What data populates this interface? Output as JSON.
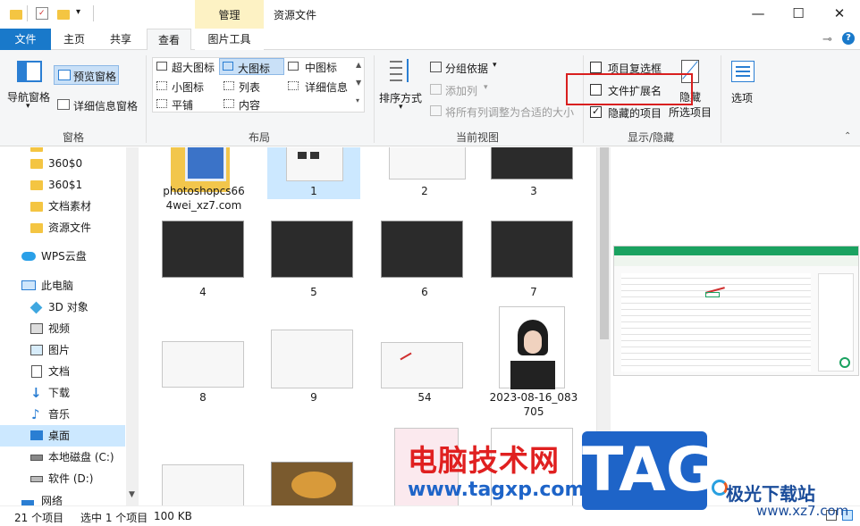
{
  "window": {
    "context_tab": "管理",
    "title": "资源文件",
    "minimize": "—",
    "maximize": "☐",
    "close": "✕"
  },
  "tabs": {
    "file": "文件",
    "home": "主页",
    "share": "共享",
    "view": "查看",
    "picture_tools": "图片工具"
  },
  "ribbon": {
    "panes": {
      "nav_pane": "导航窗格",
      "preview_pane": "预览窗格",
      "details_pane": "详细信息窗格",
      "label": "窗格"
    },
    "layout": {
      "extra_large": "超大图标",
      "large": "大图标",
      "medium": "中图标",
      "small": "小图标",
      "list": "列表",
      "details": "详细信息",
      "tiles": "平铺",
      "content": "内容",
      "label": "布局"
    },
    "current_view": {
      "sort_by": "排序方式",
      "group_by": "分组依据",
      "add_columns": "添加列",
      "size_all_columns": "将所有列调整为合适的大小",
      "label": "当前视图"
    },
    "show_hide": {
      "item_checkboxes": "项目复选框",
      "file_extensions": "文件扩展名",
      "hidden_items": "隐藏的项目",
      "hide_selected": "隐藏",
      "hide_selected_2": "所选项目",
      "label": "显示/隐藏"
    },
    "options": "选项"
  },
  "nav": {
    "items": [
      "360$0",
      "360$1",
      "文档素材",
      "资源文件",
      "WPS云盘",
      "此电脑",
      "3D 对象",
      "视频",
      "图片",
      "文档",
      "下载",
      "音乐",
      "桌面",
      "本地磁盘 (C:)",
      "软件 (D:)",
      "网络"
    ]
  },
  "files": {
    "f0_line1": "photoshopcs66",
    "f0_line2": "4wei_xz7.com",
    "f1": "1",
    "f2": "2",
    "f3": "3",
    "f4": "4",
    "f5": "5",
    "f6": "6",
    "f7": "7",
    "f8": "8",
    "f9": "9",
    "f10": "54",
    "f11_line1": "2023-08-16_083",
    "f11_line2": "705"
  },
  "status": {
    "count": "21 个项目",
    "selected": "选中 1 个项目",
    "size": "100 KB"
  },
  "watermark": {
    "cn": "电脑技术网",
    "url": "www.tagxp.com",
    "tag": "TAG",
    "right_1": "极光下载站",
    "right_2": "www.xz7.com"
  }
}
